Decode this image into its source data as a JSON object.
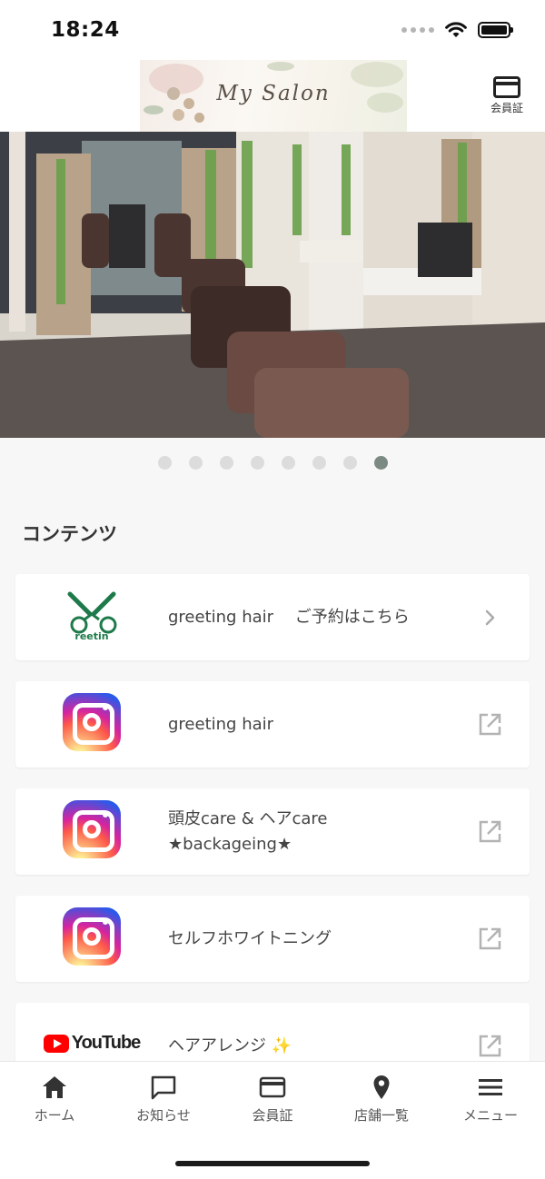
{
  "status_bar": {
    "time": "18:24"
  },
  "header": {
    "logo_text": "My Salon",
    "member_card_label": "会員証"
  },
  "carousel": {
    "page_count": 8,
    "active_index": 7
  },
  "contents": {
    "section_title": "コンテンツ",
    "items": [
      {
        "label": "greeting hair　 ご予約はこちら",
        "thumb": "greeting-logo",
        "action": "chevron-right-icon"
      },
      {
        "label": "greeting hair",
        "thumb": "instagram-logo",
        "action": "external-link-icon"
      },
      {
        "label": "頭皮care & ヘアcare\n★backageing★",
        "thumb": "instagram-logo",
        "action": "external-link-icon"
      },
      {
        "label": "セルフホワイトニング",
        "thumb": "instagram-logo",
        "action": "external-link-icon"
      },
      {
        "label": "ヘアアレンジ ✨",
        "thumb": "youtube-logo",
        "action": "external-link-icon"
      }
    ]
  },
  "youtube_logo_text": "YouTube",
  "greeting_logo_text": "reetin",
  "tab_bar": {
    "tabs": [
      {
        "label": "ホーム",
        "icon": "home-icon"
      },
      {
        "label": "お知らせ",
        "icon": "chat-icon"
      },
      {
        "label": "会員証",
        "icon": "card-icon"
      },
      {
        "label": "店舗一覧",
        "icon": "map-pin-icon"
      },
      {
        "label": "メニュー",
        "icon": "hamburger-icon"
      }
    ]
  }
}
